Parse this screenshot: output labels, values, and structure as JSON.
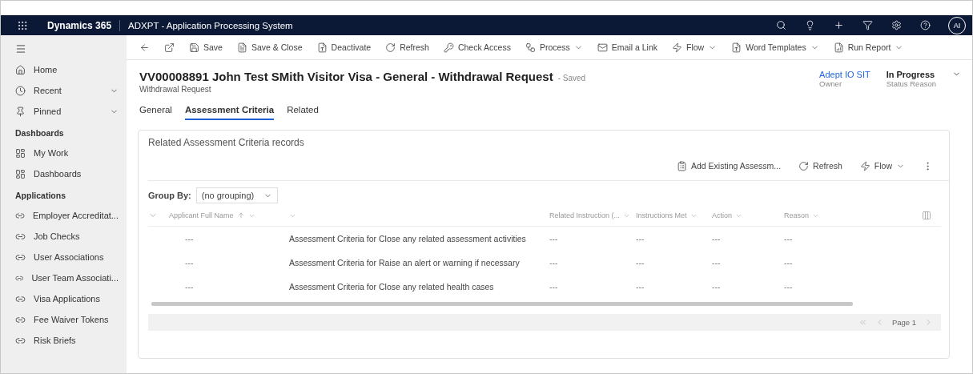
{
  "app": {
    "name": "Dynamics 365",
    "title": "ADXPT - Application Processing System",
    "avatar": "AI"
  },
  "sidebar": {
    "top_items": [
      {
        "label": "Home",
        "kind": "link"
      },
      {
        "label": "Recent",
        "kind": "menu"
      },
      {
        "label": "Pinned",
        "kind": "menu"
      }
    ],
    "sections": [
      {
        "title": "Dashboards",
        "items": [
          {
            "label": "My Work",
            "kind": "dashboard"
          },
          {
            "label": "Dashboards",
            "kind": "dashboard"
          }
        ]
      },
      {
        "title": "Applications",
        "items": [
          {
            "label": "Employer Accreditat...",
            "kind": "entity"
          },
          {
            "label": "Job Checks",
            "kind": "entity"
          },
          {
            "label": "User Associations",
            "kind": "entity"
          },
          {
            "label": "User Team Associati...",
            "kind": "entity"
          },
          {
            "label": "Visa Applications",
            "kind": "entity"
          },
          {
            "label": "Fee Waiver Tokens",
            "kind": "entity"
          },
          {
            "label": "Risk Briefs",
            "kind": "entity"
          }
        ]
      }
    ]
  },
  "commands": [
    {
      "label": "Save",
      "kind": "button"
    },
    {
      "label": "Save & Close",
      "kind": "button"
    },
    {
      "label": "Deactivate",
      "kind": "button"
    },
    {
      "label": "Refresh",
      "kind": "button"
    },
    {
      "label": "Check Access",
      "kind": "button"
    },
    {
      "label": "Process",
      "kind": "dropdown"
    },
    {
      "label": "Email a Link",
      "kind": "button"
    },
    {
      "label": "Flow",
      "kind": "dropdown"
    },
    {
      "label": "Word Templates",
      "kind": "dropdown"
    },
    {
      "label": "Run Report",
      "kind": "dropdown"
    }
  ],
  "record": {
    "title": "VV00008891 John Test SMith Visitor Visa - General - Withdrawal Request",
    "save_state": "- Saved",
    "entity": "Withdrawal Request",
    "fields": [
      {
        "value": "Adept IO SIT",
        "label": "Owner",
        "kind": "link"
      },
      {
        "value": "In Progress",
        "label": "Status Reason",
        "kind": "text"
      }
    ]
  },
  "tabs": [
    {
      "label": "General",
      "selected": false
    },
    {
      "label": "Assessment Criteria",
      "selected": true
    },
    {
      "label": "Related",
      "selected": false
    }
  ],
  "subgrid": {
    "title": "Related Assessment Criteria records",
    "commands": [
      {
        "label": "Add Existing Assessm...",
        "kind": "button"
      },
      {
        "label": "Refresh",
        "kind": "button"
      },
      {
        "label": "Flow",
        "kind": "dropdown"
      }
    ],
    "group_by": {
      "label": "Group By:",
      "value": "(no grouping)"
    },
    "columns": [
      {
        "label": "Applicant Full Name",
        "sorted": true
      },
      {
        "sorted": false
      },
      {
        "label": "Related Instruction (...",
        "sorted": false
      },
      {
        "label": "Instructions Met",
        "sorted": false
      },
      {
        "label": "Action",
        "sorted": false
      },
      {
        "label": "Reason",
        "sorted": false
      }
    ],
    "rows": [
      {
        "cells": [
          "---",
          "Assessment Criteria for Close any related assessment activities",
          "---",
          "---",
          "---",
          "---"
        ]
      },
      {
        "cells": [
          "---",
          "Assessment Criteria for Raise an alert or warning if necessary",
          "---",
          "---",
          "---",
          "---"
        ]
      },
      {
        "cells": [
          "---",
          "Assessment Criteria for Close any related health cases",
          "---",
          "---",
          "---",
          "---"
        ]
      }
    ],
    "page": "Page 1"
  }
}
